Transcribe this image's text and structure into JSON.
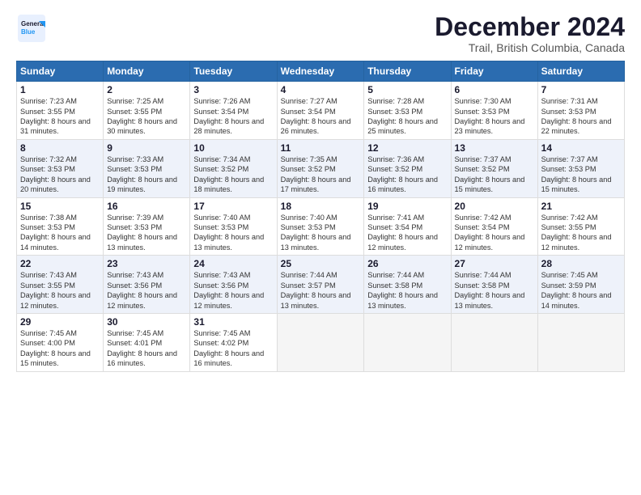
{
  "logo": {
    "general": "General",
    "blue": "Blue"
  },
  "header": {
    "month": "December 2024",
    "location": "Trail, British Columbia, Canada"
  },
  "days": [
    "Sunday",
    "Monday",
    "Tuesday",
    "Wednesday",
    "Thursday",
    "Friday",
    "Saturday"
  ],
  "weeks": [
    [
      {
        "num": "1",
        "sunrise": "7:23 AM",
        "sunset": "3:55 PM",
        "daylight": "8 hours and 31 minutes."
      },
      {
        "num": "2",
        "sunrise": "7:25 AM",
        "sunset": "3:55 PM",
        "daylight": "8 hours and 30 minutes."
      },
      {
        "num": "3",
        "sunrise": "7:26 AM",
        "sunset": "3:54 PM",
        "daylight": "8 hours and 28 minutes."
      },
      {
        "num": "4",
        "sunrise": "7:27 AM",
        "sunset": "3:54 PM",
        "daylight": "8 hours and 26 minutes."
      },
      {
        "num": "5",
        "sunrise": "7:28 AM",
        "sunset": "3:53 PM",
        "daylight": "8 hours and 25 minutes."
      },
      {
        "num": "6",
        "sunrise": "7:30 AM",
        "sunset": "3:53 PM",
        "daylight": "8 hours and 23 minutes."
      },
      {
        "num": "7",
        "sunrise": "7:31 AM",
        "sunset": "3:53 PM",
        "daylight": "8 hours and 22 minutes."
      }
    ],
    [
      {
        "num": "8",
        "sunrise": "7:32 AM",
        "sunset": "3:53 PM",
        "daylight": "8 hours and 20 minutes."
      },
      {
        "num": "9",
        "sunrise": "7:33 AM",
        "sunset": "3:53 PM",
        "daylight": "8 hours and 19 minutes."
      },
      {
        "num": "10",
        "sunrise": "7:34 AM",
        "sunset": "3:52 PM",
        "daylight": "8 hours and 18 minutes."
      },
      {
        "num": "11",
        "sunrise": "7:35 AM",
        "sunset": "3:52 PM",
        "daylight": "8 hours and 17 minutes."
      },
      {
        "num": "12",
        "sunrise": "7:36 AM",
        "sunset": "3:52 PM",
        "daylight": "8 hours and 16 minutes."
      },
      {
        "num": "13",
        "sunrise": "7:37 AM",
        "sunset": "3:52 PM",
        "daylight": "8 hours and 15 minutes."
      },
      {
        "num": "14",
        "sunrise": "7:37 AM",
        "sunset": "3:53 PM",
        "daylight": "8 hours and 15 minutes."
      }
    ],
    [
      {
        "num": "15",
        "sunrise": "7:38 AM",
        "sunset": "3:53 PM",
        "daylight": "8 hours and 14 minutes."
      },
      {
        "num": "16",
        "sunrise": "7:39 AM",
        "sunset": "3:53 PM",
        "daylight": "8 hours and 13 minutes."
      },
      {
        "num": "17",
        "sunrise": "7:40 AM",
        "sunset": "3:53 PM",
        "daylight": "8 hours and 13 minutes."
      },
      {
        "num": "18",
        "sunrise": "7:40 AM",
        "sunset": "3:53 PM",
        "daylight": "8 hours and 13 minutes."
      },
      {
        "num": "19",
        "sunrise": "7:41 AM",
        "sunset": "3:54 PM",
        "daylight": "8 hours and 12 minutes."
      },
      {
        "num": "20",
        "sunrise": "7:42 AM",
        "sunset": "3:54 PM",
        "daylight": "8 hours and 12 minutes."
      },
      {
        "num": "21",
        "sunrise": "7:42 AM",
        "sunset": "3:55 PM",
        "daylight": "8 hours and 12 minutes."
      }
    ],
    [
      {
        "num": "22",
        "sunrise": "7:43 AM",
        "sunset": "3:55 PM",
        "daylight": "8 hours and 12 minutes."
      },
      {
        "num": "23",
        "sunrise": "7:43 AM",
        "sunset": "3:56 PM",
        "daylight": "8 hours and 12 minutes."
      },
      {
        "num": "24",
        "sunrise": "7:43 AM",
        "sunset": "3:56 PM",
        "daylight": "8 hours and 12 minutes."
      },
      {
        "num": "25",
        "sunrise": "7:44 AM",
        "sunset": "3:57 PM",
        "daylight": "8 hours and 13 minutes."
      },
      {
        "num": "26",
        "sunrise": "7:44 AM",
        "sunset": "3:58 PM",
        "daylight": "8 hours and 13 minutes."
      },
      {
        "num": "27",
        "sunrise": "7:44 AM",
        "sunset": "3:58 PM",
        "daylight": "8 hours and 13 minutes."
      },
      {
        "num": "28",
        "sunrise": "7:45 AM",
        "sunset": "3:59 PM",
        "daylight": "8 hours and 14 minutes."
      }
    ],
    [
      {
        "num": "29",
        "sunrise": "7:45 AM",
        "sunset": "4:00 PM",
        "daylight": "8 hours and 15 minutes."
      },
      {
        "num": "30",
        "sunrise": "7:45 AM",
        "sunset": "4:01 PM",
        "daylight": "8 hours and 16 minutes."
      },
      {
        "num": "31",
        "sunrise": "7:45 AM",
        "sunset": "4:02 PM",
        "daylight": "8 hours and 16 minutes."
      },
      null,
      null,
      null,
      null
    ]
  ],
  "labels": {
    "sunrise": "Sunrise:",
    "sunset": "Sunset:",
    "daylight": "Daylight:"
  }
}
